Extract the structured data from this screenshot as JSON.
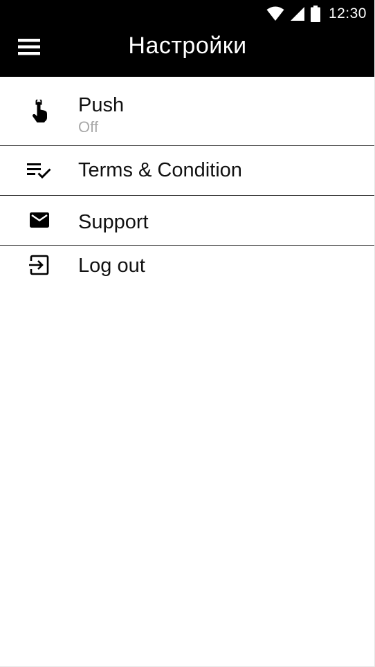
{
  "status_bar": {
    "time": "12:30",
    "icons": [
      "wifi-icon",
      "cellular-signal-icon",
      "battery-icon"
    ]
  },
  "app_bar": {
    "menu_icon": "hamburger-menu-icon",
    "title": "Настройки"
  },
  "settings": {
    "items": [
      {
        "label": "Push",
        "value": "Off",
        "icon": "touch-hand-icon"
      },
      {
        "label": "Terms & Condition",
        "icon": "checklist-icon"
      },
      {
        "label": "Support",
        "icon": "mail-icon"
      },
      {
        "label": "Log out",
        "icon": "logout-icon"
      }
    ]
  },
  "colors": {
    "app_bar_background": "#000000",
    "app_bar_text": "#ffffff",
    "primary_text": "#111111",
    "secondary_text": "#a8a8a8",
    "divider": "#3a3a3a",
    "page_background": "#ffffff"
  }
}
